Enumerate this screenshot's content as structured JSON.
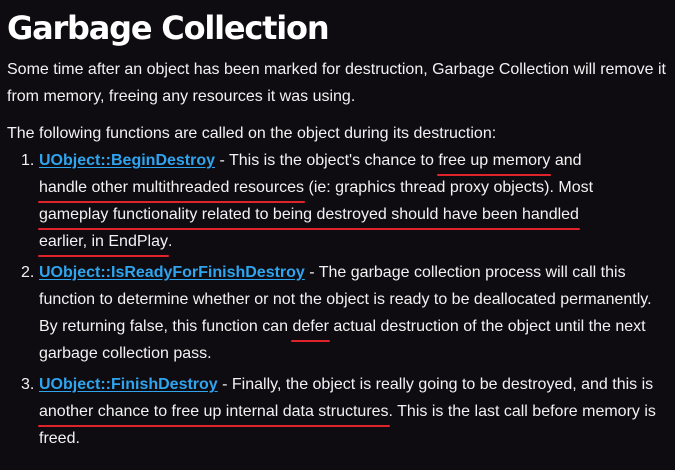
{
  "title": "Garbage Collection",
  "intro": "Some time after an object has been marked for destruction, Garbage Collection will remove it from memory, freeing any resources it was using.",
  "lead": "The following functions are called on the object during its destruction:",
  "colors": {
    "background": "#0e0c10",
    "text": "#ffffff",
    "link": "#2fa4ef",
    "annotation_underline": "#e0232a"
  },
  "steps": [
    {
      "number": "1.",
      "function": "UObject::BeginDestroy",
      "parts": [
        " - This is the object's chance to ",
        "free up memory",
        " and ",
        "handle other multithreaded resources",
        " (ie: graphics thread proxy objects). Most ",
        "gameplay functionality related to being destroyed should have been handled",
        " ",
        "earlier, in EndPlay",
        "."
      ]
    },
    {
      "number": "2.",
      "function": "UObject::IsReadyForFinishDestroy",
      "parts": [
        " - The garbage collection process will call this function to determine whether or not the object is ready to be deallocated permanently. By returning false, this function can ",
        "defer",
        " actual destruction of the object until the next garbage collection pass."
      ]
    },
    {
      "number": "3.",
      "function": "UObject::FinishDestroy",
      "parts": [
        " - Finally, the object is really going to be destroyed, and this is ",
        "another chance to free up internal data structures",
        ". This is the last call before memory is freed."
      ]
    }
  ]
}
